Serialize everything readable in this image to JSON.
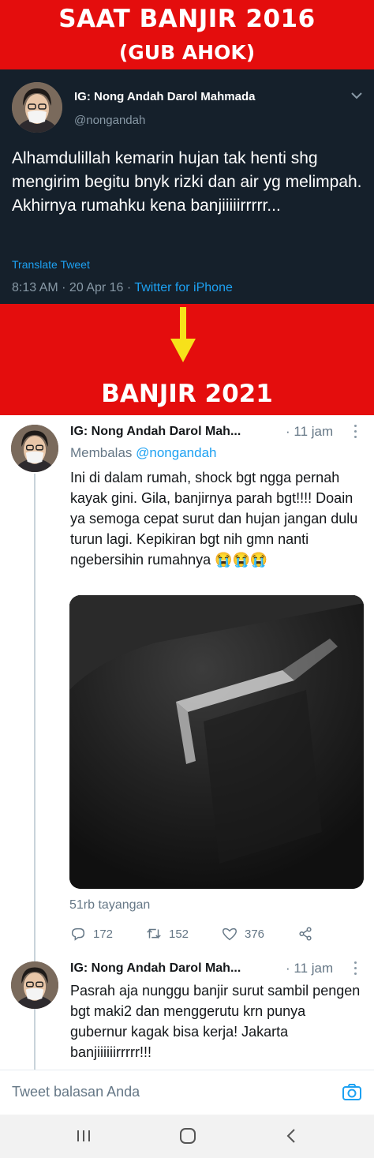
{
  "banner_top": {
    "line1": "SAAT BANJIR 2016",
    "line2": "(GUB AHOK)"
  },
  "tweet_2016": {
    "name": "IG: Nong Andah Darol Mahmada",
    "handle": "@nongandah",
    "text": "Alhamdulillah kemarin hujan tak henti shg mengirim begitu bnyk rizki dan air yg melimpah. Akhirnya rumahku kena banjiiiiirrrrr...",
    "translate": "Translate Tweet",
    "meta_time": "8:13 AM · 20 Apr 16 · ",
    "meta_via": "Twitter for iPhone"
  },
  "banner_mid": {
    "title": "BANJIR 2021"
  },
  "tweet_2021_a": {
    "name": "IG: Nong Andah Darol Mah...",
    "time": "· 11 jam",
    "reply_label": "Membalas ",
    "reply_handle": "@nongandah",
    "text": "Ini di dalam rumah, shock bgt ngga pernah kayak gini. Gila, banjirnya parah bgt!!!! Doain ya semoga cepat surut dan hujan jangan dulu turun lagi. Kepikiran bgt nih gmn nanti ngebersihin rumahnya 😭😭😭",
    "views": "51rb tayangan",
    "replies": "172",
    "retweets": "152",
    "likes": "376"
  },
  "tweet_2021_b": {
    "name": "IG: Nong Andah Darol Mah...",
    "time": "· 11 jam",
    "text": "Pasrah aja nunggu banjir surut sambil pengen bgt maki2 dan menggerutu krn punya gubernur kagak bisa kerja! Jakarta banjiiiiiirrrrr!!!"
  },
  "reply_bar": {
    "placeholder": "Tweet balasan Anda"
  },
  "colors": {
    "banner_red": "#e40d0d",
    "dark_bg": "#15202b",
    "twitter_blue": "#1da1f2",
    "arrow_yellow": "#f7e11a"
  }
}
